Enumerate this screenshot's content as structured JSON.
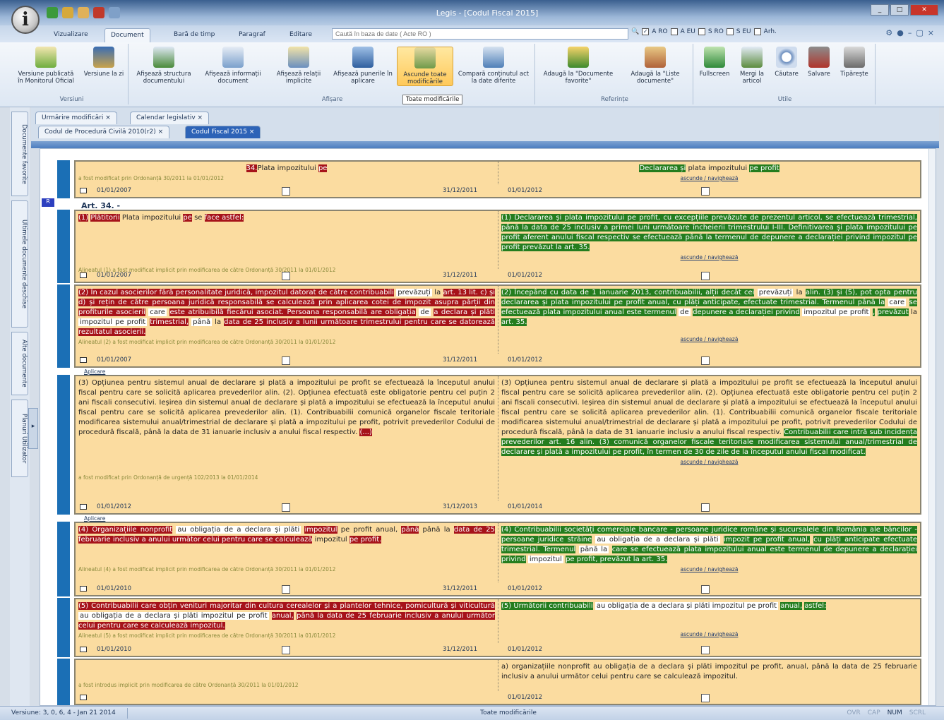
{
  "app": {
    "window_title": "Legis - [Codul Fiscal 2015]",
    "win_controls": [
      "_",
      "□",
      "✕"
    ]
  },
  "ribbon_tabs": [
    "Vizualizare",
    "Document",
    "Bară de timp",
    "Paragraf",
    "Editare"
  ],
  "search": {
    "placeholder": "Caută în baza de date ( Acte RO )",
    "options": [
      {
        "label": "A RO",
        "checked": true
      },
      {
        "label": "A EU",
        "checked": false
      },
      {
        "label": "S RO",
        "checked": false
      },
      {
        "label": "S EU",
        "checked": false
      },
      {
        "label": "Arh.",
        "checked": false
      }
    ]
  },
  "ribbon": {
    "groups": [
      {
        "label": "Versiuni",
        "buttons": [
          "Versiune publicată în Monitorul Oficial",
          "Versiune la zi"
        ]
      },
      {
        "label": "Afișare",
        "buttons": [
          "Afișează structura documentului",
          "Afișează informații document",
          "Afișează relații implicite",
          "Afișează punerile în aplicare",
          "Ascunde toate modificările",
          "Compară conținutul act la date diferite"
        ]
      },
      {
        "label": "Referințe",
        "buttons": [
          "Adaugă la \"Documente favorite\"",
          "Adaugă la \"Liste documente\""
        ]
      },
      {
        "label": "Utile",
        "buttons": [
          "Fullscreen",
          "Mergi la articol",
          "Căutare",
          "Salvare",
          "Tipărește"
        ]
      }
    ],
    "tooltip": "Toate modificările"
  },
  "side_tabs": [
    "Documente favorite",
    "Ultimele documente deschise",
    "Alte documente",
    "Planuri Utilizator"
  ],
  "doc_tabs_row1": [
    "Urmărire modificări",
    "Calendar legislativ"
  ],
  "doc_tabs_row2": [
    "Codul de Procedură Civilă 2010(r2)",
    "Codul Fiscal 2015"
  ],
  "article": {
    "label": "Art. 34. -",
    "flag": "R"
  },
  "blocks": [
    {
      "left_html": "<div style='text-align:center'><span class='del'>34.</span>Plata impozitului <span class='del'>pe</span></div><span class='note'>a fost modificat prin Ordonanță 30/2011 la 01/01/2012</span>",
      "right_html": "<div style='text-align:center'><span class='add'>Declararea și</span> plata impozitului <span class='add'>pe profit</span></div><span class='links'>ascunde / navighează</span>",
      "d1": "01/01/2007",
      "d2": "31/12/2011",
      "d3": "01/01/2012",
      "aplicare": ""
    },
    {
      "left_html": "<span class='del'>(1)</span> <span class='del'>Plătitorii</span> Plata impozitului <span class='del'>pe</span> se <span class='del'>face astfel:</span><span class='note' style='margin-top:62px'>Alineatul (1) a fost modificat implicit prin modificarea de către Ordonanță 30/2011 la 01/01/2012</span>",
      "right_html": "<span class='add'>(1) Declararea și plata impozitului pe profit, cu excepțiile prevăzute de prezentul articol, se efectuează trimestrial, până la data de 25 inclusiv a primei luni următoare încheierii trimestrului I-III. Definitivarea și plata impozitului pe profit aferent anului fiscal respectiv se efectuează până la termenul de depunere a declarației privind impozitul pe profit prevăzut la art. 35.</span><span class='links'>ascunde / navighează</span>",
      "d1": "01/01/2007",
      "d2": "31/12/2011",
      "d3": "01/01/2012",
      "aplicare": ""
    },
    {
      "left_html": "<span class='del'>(2) În cazul asocierilor fără personalitate juridică, impozitul datorat de către contribuabili</span> <span class='keep'>prevăzuți</span> la <span class='del'>art. 13 lit. c) și d) și rețin de către persoana juridică responsabilă se calculează prin aplicarea cotei de impozit asupra părții din profiturile asocierii</span> <span class='keep'>care</span> <span class='del'>este atribuibilă fiecărui asociat. Persoana responsabilă are obligația</span> <span class='keep'>de</span> <span class='del'>a declara și plăti</span> <span class='keep'>impozitul pe profit</span> <span class='del'>trimestrial,</span> <span class='keep'>până</span> la <span class='del'>data de 25 inclusiv a lunii următoare trimestrului pentru care se datorează rezultatul asocierii.</span><span class='note'>Alineatul (2) a fost modificat implicit prin modificarea de către Ordonanță 30/2011 la 01/01/2012</span>",
      "right_html": "<span class='add'>(2) Începând cu data de 1 ianuarie 2013, contribuabilii, alții decât cei</span> <span class='keep'>prevăzuți</span> la <span class='add'>alin. (3) și (5), pot opta pentru declararea și plata impozitului pe profit anual, cu plăți anticipate, efectuate trimestrial. Termenul până la</span> <span class='keep'>care</span> <span class='add'>se efectuează plata impozitului anual este termenul</span> <span class='keep'>de</span> <span class='add'>depunere a declarației privind</span> <span class='keep'>impozitul pe profit</span> <span class='add'>,</span> <span class='add'>prevăzut</span> la <span class='add'>art. 35.</span><span class='links' style='margin-top:12px'>ascunde / navighează</span>",
      "d1": "01/01/2007",
      "d2": "31/12/2011",
      "d3": "01/01/2012",
      "aplicare": "Aplicare"
    },
    {
      "left_html": "(3) Opțiunea pentru sistemul anual de declarare și plată a impozitului pe profit se efectuează la începutul anului fiscal pentru care se solicită aplicarea prevederilor alin. (2). Opțiunea efectuată este obligatorie pentru cel puțin 2 ani fiscali consecutivi. Ieșirea din sistemul anual de declarare și plată a impozitului se efectuează la începutul anului fiscal pentru care se solicită aplicarea prevederilor alin. (1). Contribuabilii comunică organelor fiscale teritoriale modificarea sistemului anual/trimestrial de declarare și plată a impozitului pe profit, potrivit prevederilor Codului de procedură fiscală, până la data de 31 ianuarie inclusiv a anului fiscal respectiv. <span class='del'>(...)</span><span class='note' style='margin-top:52px'>a fost modificat prin Ordonanță de urgență 102/2013 la 01/01/2014</span>",
      "right_html": "(3) Opțiunea pentru sistemul anual de declarare și plată a impozitului pe profit se efectuează la începutul anului fiscal pentru care se solicită aplicarea prevederilor alin. (2). Opțiunea efectuată este obligatorie pentru cel puțin 2 ani fiscali consecutivi. Ieșirea din sistemul anual de declarare și plată a impozitului se efectuează la începutul anului fiscal pentru care se solicită aplicarea prevederilor alin. (1). Contribuabilii comunică organelor fiscale teritoriale modificarea sistemului anual/trimestrial de declarare și plată a impozitului pe profit, potrivit prevederilor Codului de procedură fiscală, până la data de 31 ianuarie inclusiv a anului fiscal respectiv. <span class='add'>Contribuabilii care intră sub incidența prevederilor art. 16 alin. (3) comunică organelor fiscale teritoriale modificarea sistemului anual/trimestrial de declarare și plată a impozitului pe profit, în termen de 30 de zile de la începutul anului fiscal modificat.</span><span class='links'>ascunde / navighează</span>",
      "d1": "01/01/2012",
      "d2": "31/12/2013",
      "d3": "01/01/2014",
      "aplicare": "Aplicare"
    },
    {
      "left_html": "<span class='del'>(4) Organizațiile nonprofit</span> <span class='keep'>au obligația de a declara și plăti</span> <span class='del'>impozitul</span> pe profit anual, <span class='del'>până</span> până la <span class='del'>data de 25 februarie inclusiv a anului următor celui pentru care se calculează</span> impozitul <span class='del'>pe profit.</span><span class='note' style='margin-top:30px'>Alineatul (4) a fost modificat implicit prin modificarea de către Ordonanță 30/2011 la 01/01/2012</span>",
      "right_html": "<span class='add'>(4) Contribuabilii societăți comerciale bancare - persoane juridice române și sucursalele din România ale băncilor - persoane juridice străine</span> <span class='keep'>au obligația de a declara și plăti</span> <span class='add'>impozit pe profit anual,</span> <span class='add'>cu plăți anticipate efectuate trimestrial. Termenul</span> <span class='keep'>până la</span> <span class='add'>care se efectuează plata impozitului anual este termenul de depunere a declarației privind</span> <span class='keep'>impozitul</span> <span class='add'>pe profit, prevăzut la art. 35.</span><span class='links'>ascunde / navighează</span>",
      "d1": "01/01/2010",
      "d2": "31/12/2011",
      "d3": "01/01/2012",
      "aplicare": "Aplicare"
    },
    {
      "left_html": "<span class='del'>(5) Contribuabilii care obțin venituri majoritar din cultura cerealelor și a plantelor tehnice, pomicultură și viticultură</span> <span class='keep'>au obligația de a declara și plăti impozitul pe profit</span> <span class='del'>anual,</span> <span class='del'>până la data de 25 februarie inclusiv a anului următor celui pentru care se calculează impozitul.</span><span class='note'>Alineatul (5) a fost modificat implicit prin modificarea de către Ordonanță 30/2011 la 01/01/2012</span>",
      "right_html": "<span class='add'>(5) Următorii contribuabili</span> <span class='keep'>au obligația de a declara și plăti impozitul pe profit</span> <span class='add'>anual,</span> <span class='add'>astfel:</span><span class='links' style='margin-top:28px'>ascunde / navighează</span>",
      "d1": "01/01/2010",
      "d2": "31/12/2011",
      "d3": "01/01/2012",
      "aplicare": ""
    },
    {
      "left_html": "<span class='note' style='margin-top:28px'>a fost introdus implicit prin modificarea de către Ordonanță 30/2011 la 01/01/2012</span>",
      "right_html": "a) organizațiile nonprofit au obligația de a declara și plăti impozitul pe profit, anual, până la data de 25 februarie inclusiv a anului următor celui pentru care se calculează impozitul.",
      "d1": "",
      "d2": "",
      "d3": "01/01/2012",
      "aplicare": "Aplicare"
    }
  ],
  "status": {
    "version": "Versiune: 3, 0, 6, 4 - Jan 21 2014",
    "center": "Toate modificările",
    "keys": [
      "OVR",
      "CAP",
      "NUM",
      "SCRL"
    ]
  }
}
